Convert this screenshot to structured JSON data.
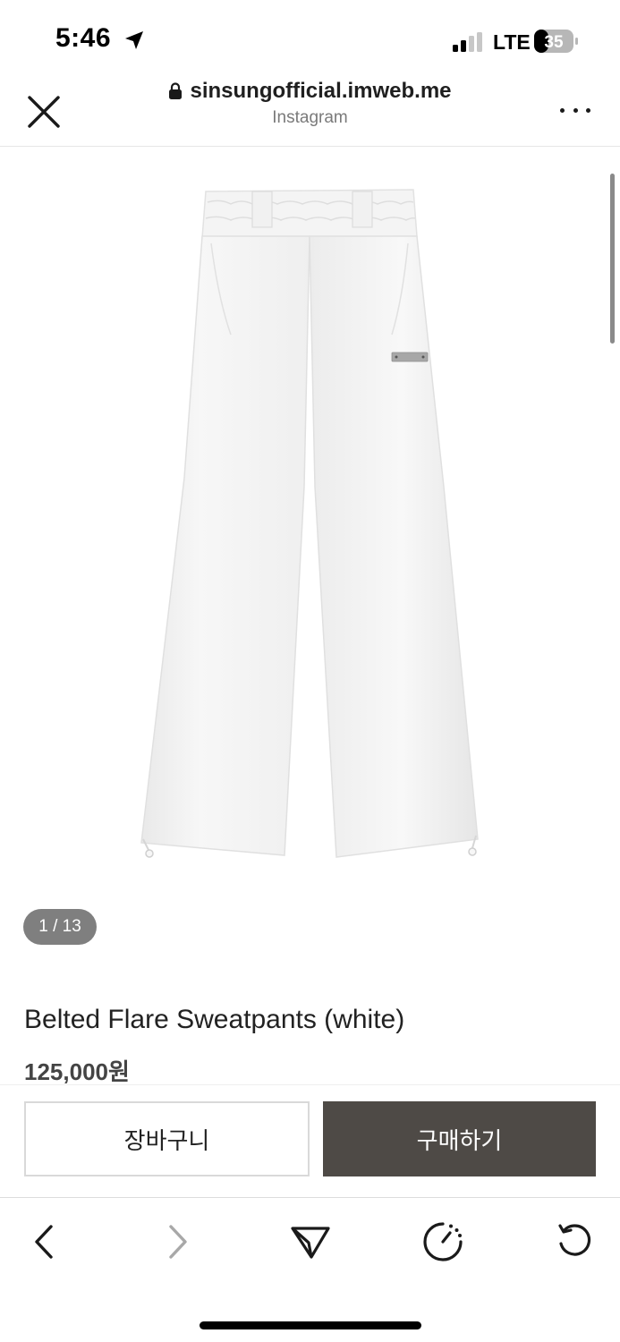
{
  "status_bar": {
    "time": "5:46",
    "network": "LTE",
    "battery_level": "35"
  },
  "browser": {
    "url": "sinsungofficial.imweb.me",
    "source": "Instagram"
  },
  "product": {
    "image_counter": "1 / 13",
    "title": "Belted Flare Sweatpants (white)",
    "price": "125,000원"
  },
  "actions": {
    "cart_label": "장바구니",
    "buy_label": "구매하기",
    "buy_color": "#4e4a46"
  },
  "toolbar": {
    "icons": [
      "back-icon",
      "forward-icon",
      "share-icon",
      "speed-icon",
      "refresh-icon"
    ]
  }
}
